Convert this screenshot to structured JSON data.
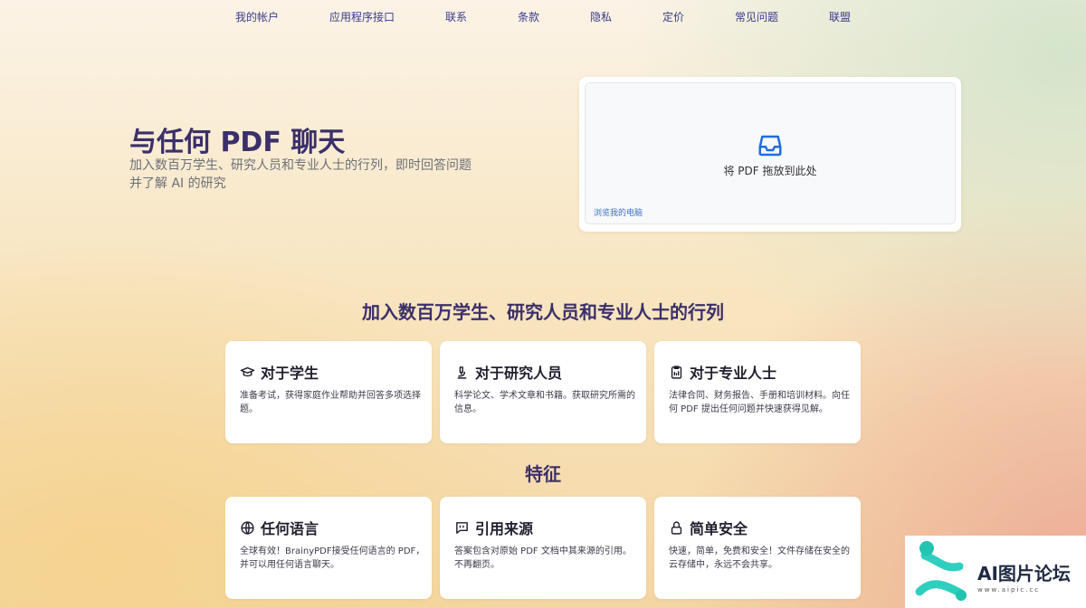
{
  "nav": {
    "items": [
      {
        "label": "我的帐户"
      },
      {
        "label": "应用程序接口"
      },
      {
        "label": "联系"
      },
      {
        "label": "条款"
      },
      {
        "label": "隐私"
      },
      {
        "label": "定价"
      },
      {
        "label": "常见问题"
      },
      {
        "label": "联盟"
      }
    ]
  },
  "hero": {
    "title": "与任何 PDF 聊天",
    "subtitle": "加入数百万学生、研究人员和专业人士的行列，即时回答问题并了解 AI 的研究"
  },
  "upload": {
    "icon": "inbox-icon",
    "drop_text": "将 PDF 拖放到此处",
    "browse_label": "浏览我的电脑"
  },
  "audience": {
    "title": "加入数百万学生、研究人员和专业人士的行列",
    "cards": [
      {
        "icon": "school-icon",
        "title": "对于学生",
        "desc": "准备考试，获得家庭作业帮助并回答多项选择题。"
      },
      {
        "icon": "microscope-icon",
        "title": "对于研究人员",
        "desc": "科学论文、学术文章和书籍。获取研究所需的信息。"
      },
      {
        "icon": "clipboard-icon",
        "title": "对于专业人士",
        "desc": "法律合同、财务报告、手册和培训材料。向任何 PDF 提出任何问题并快速获得见解。"
      }
    ]
  },
  "features": {
    "title": "特征",
    "cards": [
      {
        "icon": "globe-icon",
        "title": "任何语言",
        "desc": "全球有效！BrainyPDF接受任何语言的 PDF，并可以用任何语言聊天。"
      },
      {
        "icon": "quote-icon",
        "title": "引用来源",
        "desc": "答案包含对原始 PDF 文档中其来源的引用。不再翻页。"
      },
      {
        "icon": "lock-icon",
        "title": "简单安全",
        "desc": "快速，简单，免费和安全！文件存储在安全的云存储中，永远不会共享。"
      }
    ]
  },
  "watermark": {
    "text": "AI图片论坛",
    "url": "www.aipic.cc"
  },
  "colors": {
    "accent": "#3b2f6b",
    "nav_link": "#3b3a8c",
    "upload_icon": "#1e6fd9",
    "link": "#3c6fc4"
  }
}
